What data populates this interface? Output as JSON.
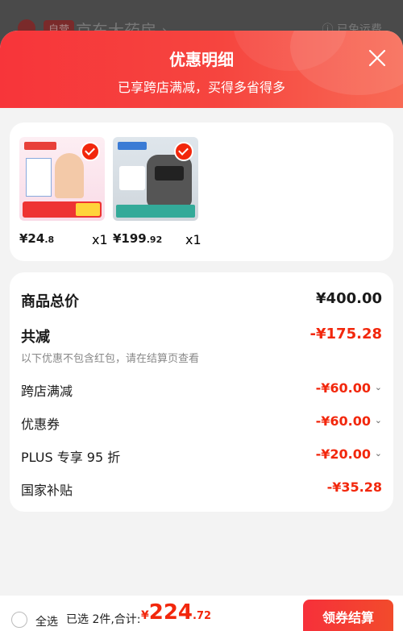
{
  "background": {
    "tag": "自营",
    "store_name": "京东大药房 ›",
    "shipping": "ⓘ 已免运费"
  },
  "header": {
    "title": "优惠明细",
    "subtitle": "已享跨店满减，买得多省得多"
  },
  "products": [
    {
      "price_int": "¥24",
      "price_dec": ".8",
      "qty": "x1"
    },
    {
      "price_int": "¥199",
      "price_dec": ".92",
      "qty": "x1"
    }
  ],
  "summary": {
    "total_label": "商品总价",
    "total_value": "¥400.00",
    "reduce_label": "共减",
    "reduce_value": "-¥175.28",
    "note": "以下优惠不包含红包，请在结算页查看",
    "items": [
      {
        "label": "跨店满减",
        "value": "-¥60.00"
      },
      {
        "label": "优惠券",
        "value": "-¥60.00"
      },
      {
        "label": "PLUS 专享 95 折",
        "value": "-¥20.00"
      },
      {
        "label": "国家补贴",
        "value": "-¥35.28"
      }
    ]
  },
  "footer": {
    "select_all": "全选",
    "selected": "已选 2件,合计:",
    "yen": "¥",
    "amount_int": "224",
    "amount_dec": ".72",
    "button": "领券结算"
  },
  "colors": {
    "accent": "#f2270c",
    "header_start": "#f7353a",
    "header_end": "#f86a55"
  }
}
